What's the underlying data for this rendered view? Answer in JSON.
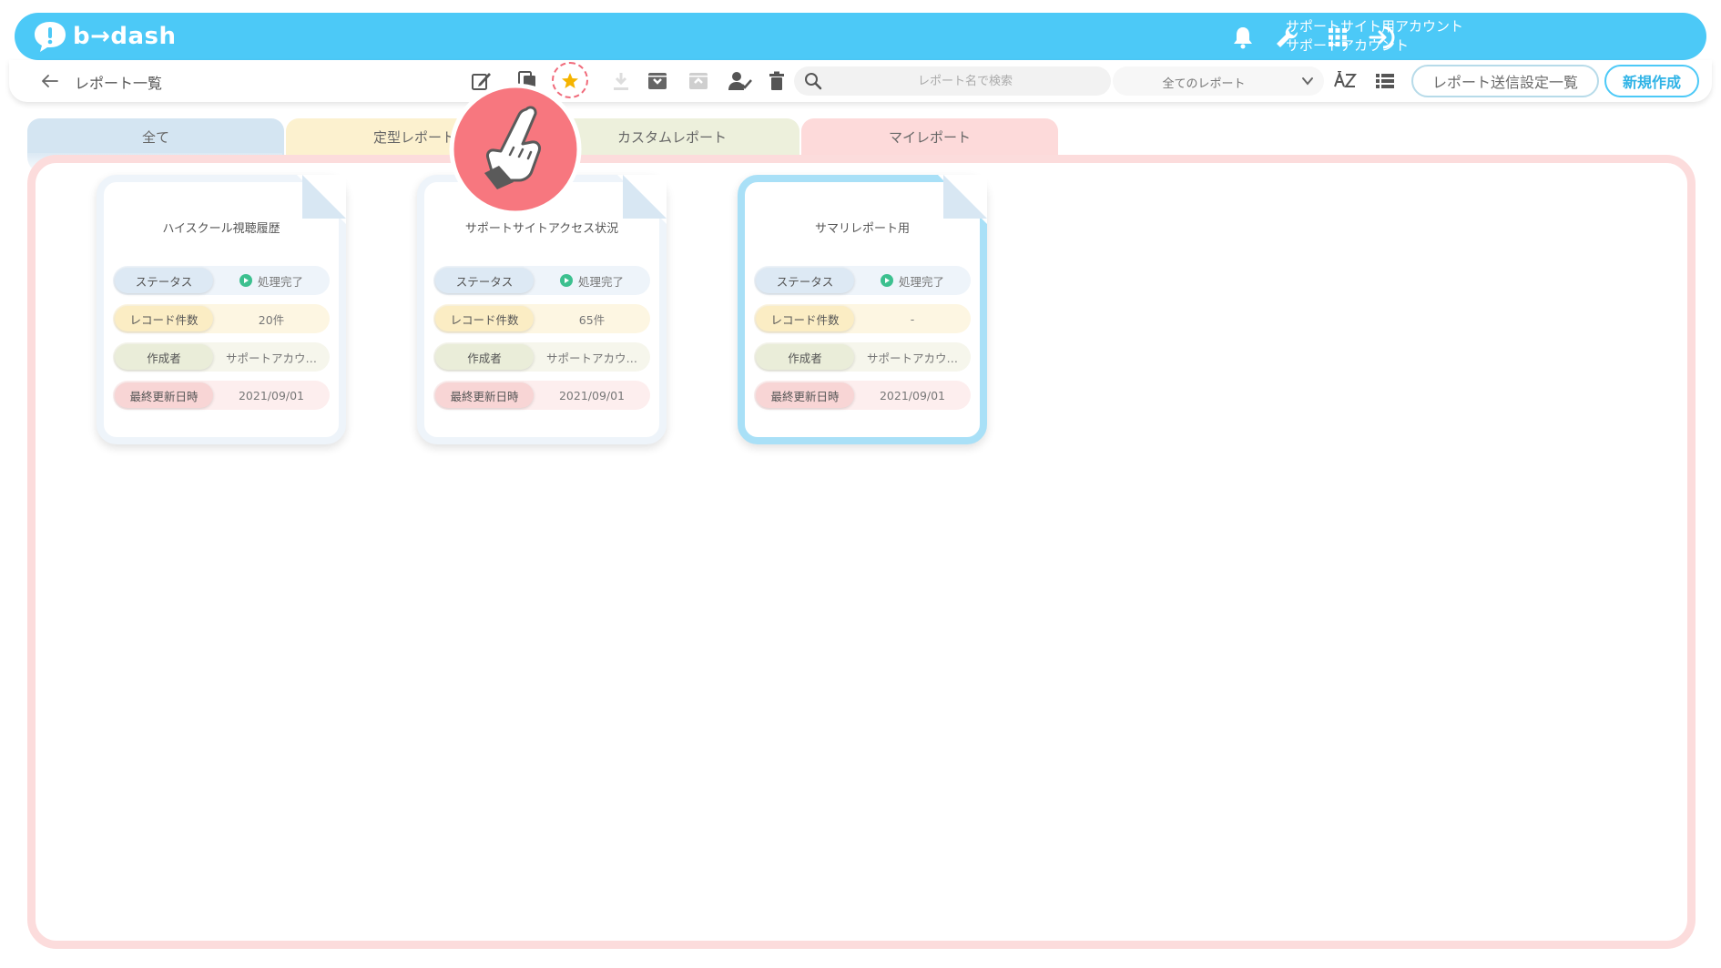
{
  "header": {
    "logo_text": "b→dash",
    "account_line1": "サポートサイト用アカウント",
    "account_line2": "サポートアカウント",
    "icons": [
      "bell-icon",
      "wrench-icon",
      "apps-grid-icon",
      "logout-icon"
    ]
  },
  "toolbar": {
    "page_title": "レポート一覧",
    "icons": [
      "edit-icon",
      "copy-icon",
      "star-icon",
      "download-icon",
      "archive-icon",
      "unarchive-icon",
      "user-assign-icon",
      "trash-icon",
      "sort-az-icon",
      "list-view-icon"
    ],
    "search_placeholder": "レポート名で検索",
    "filter_value": "全てのレポート",
    "send_settings_label": "レポート送信設定一覧",
    "new_label": "新規作成"
  },
  "tabs": [
    {
      "label": "全て"
    },
    {
      "label": "定型レポート"
    },
    {
      "label": "カスタムレポート"
    },
    {
      "label": "マイレポート"
    }
  ],
  "row_labels": {
    "status": "ステータス",
    "record_count": "レコード件数",
    "author": "作成者",
    "updated": "最終更新日時"
  },
  "cards": [
    {
      "title": "ハイスクール視聴履歴",
      "status": "処理完了",
      "record_count": "20件",
      "author": "サポートアカウ…",
      "updated": "2021/09/01",
      "selected": false
    },
    {
      "title": "サポートサイトアクセス状況",
      "status": "処理完了",
      "record_count": "65件",
      "author": "サポートアカウ…",
      "updated": "2021/09/01",
      "selected": false
    },
    {
      "title": "サマリレポート用",
      "status": "処理完了",
      "record_count": "-",
      "author": "サポートアカウ…",
      "updated": "2021/09/01",
      "selected": true
    }
  ],
  "colors": {
    "brand": "#4cc9f7",
    "status_done": "#3cc08f",
    "highlight": "#f06a7a"
  }
}
